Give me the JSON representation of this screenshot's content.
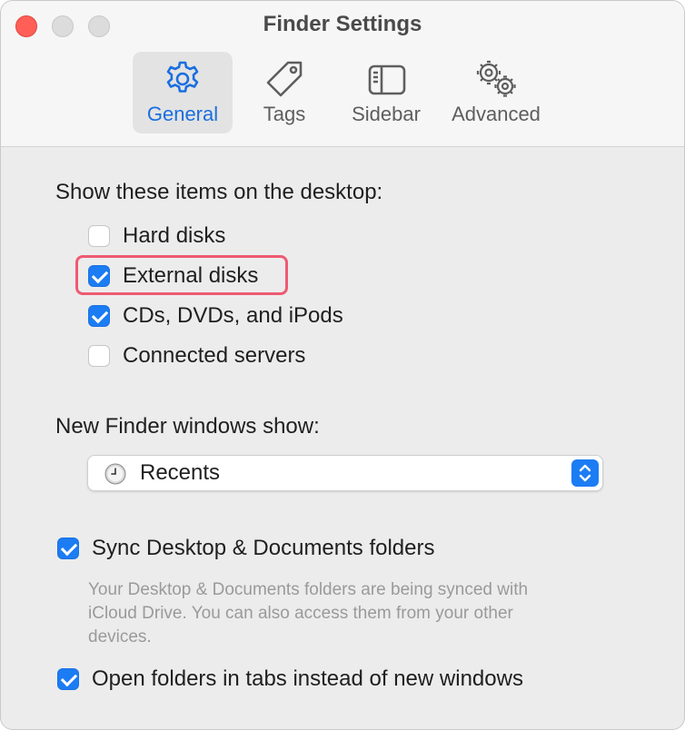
{
  "window": {
    "title": "Finder Settings"
  },
  "tabs": [
    {
      "label": "General",
      "icon": "gear-icon",
      "active": true
    },
    {
      "label": "Tags",
      "icon": "tag-icon",
      "active": false
    },
    {
      "label": "Sidebar",
      "icon": "sidebar-icon",
      "active": false
    },
    {
      "label": "Advanced",
      "icon": "gears-icon",
      "active": false
    }
  ],
  "desktop_items": {
    "heading": "Show these items on the desktop:",
    "options": [
      {
        "label": "Hard disks",
        "checked": false
      },
      {
        "label": "External disks",
        "checked": true
      },
      {
        "label": "CDs, DVDs, and iPods",
        "checked": true
      },
      {
        "label": "Connected servers",
        "checked": false
      }
    ]
  },
  "new_windows": {
    "heading": "New Finder windows show:",
    "selected": "Recents",
    "icon": "clock-icon"
  },
  "sync": {
    "label": "Sync Desktop & Documents folders",
    "checked": true,
    "description": "Your Desktop & Documents folders are being synced with iCloud Drive. You can also access them from your other devices."
  },
  "open_tabs": {
    "label": "Open folders in tabs instead of new windows",
    "checked": true
  },
  "colors": {
    "accent": "#1c7cf4",
    "highlight": "#ee5a72",
    "close": "#ff5f57"
  }
}
